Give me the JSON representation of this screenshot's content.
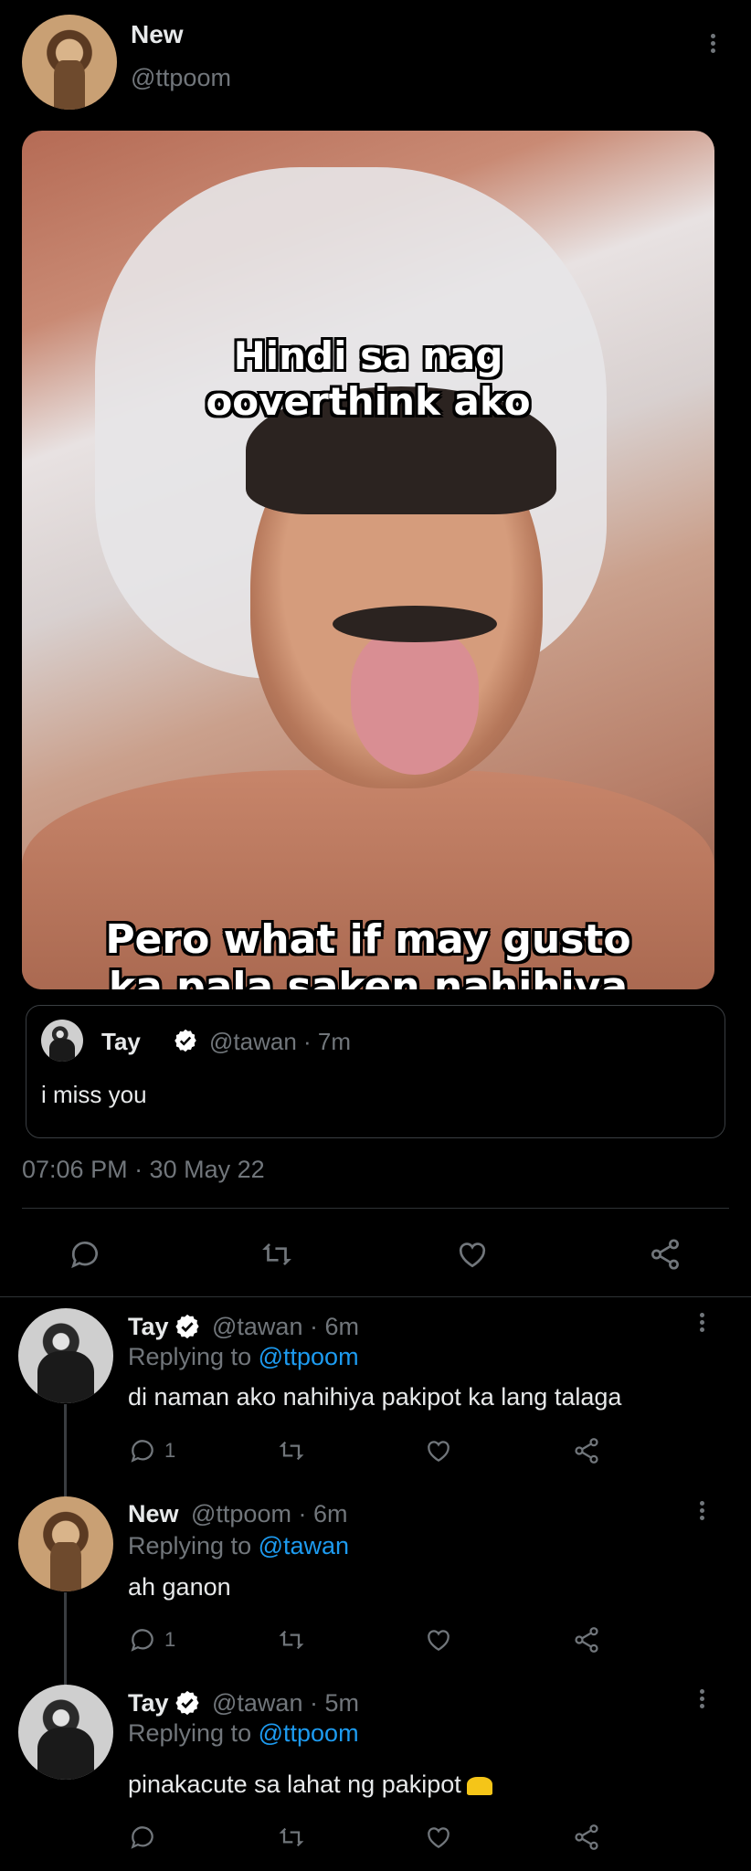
{
  "main_tweet": {
    "author_name": "New",
    "author_handle": "@ttpoom",
    "image_caption_top": "Hindi sa nag\nooverthink ako",
    "image_caption_bottom": "Pero what if may gusto\nka pala saken nahihiya\nkalang magsabi",
    "quoted": {
      "author_name": "Tay",
      "meta": "@tawan · 7m",
      "text": "i miss you"
    },
    "timestamp": "07:06 PM · 30 May 22"
  },
  "replies": [
    {
      "author_name": "Tay",
      "meta": "@tawan · 6m",
      "replying_prefix": "Replying to",
      "replying_to": "@ttpoom",
      "text": "di naman ako nahihiya pakipot ka lang talaga",
      "reply_count": "1",
      "verified": true
    },
    {
      "author_name": "New",
      "meta": "@ttpoom · 6m",
      "replying_prefix": "Replying to",
      "replying_to": "@tawan",
      "text": "ah ganon",
      "reply_count": "1",
      "verified": false
    },
    {
      "author_name": "Tay",
      "meta": "@tawan · 5m",
      "replying_prefix": "Replying to",
      "replying_to": "@ttpoom",
      "text": "pinakacute sa lahat ng pakipot",
      "reply_count": "",
      "verified": true
    }
  ],
  "colors": {
    "background": "#000000",
    "text": "#e7e9ea",
    "muted": "#71767b",
    "link": "#1d9bf0",
    "verified_badge": "#ffffff"
  },
  "icons": [
    "more-vertical-icon",
    "reply-icon",
    "retweet-icon",
    "like-icon",
    "share-icon",
    "verified-badge-icon",
    "heart-hands-emoji"
  ]
}
